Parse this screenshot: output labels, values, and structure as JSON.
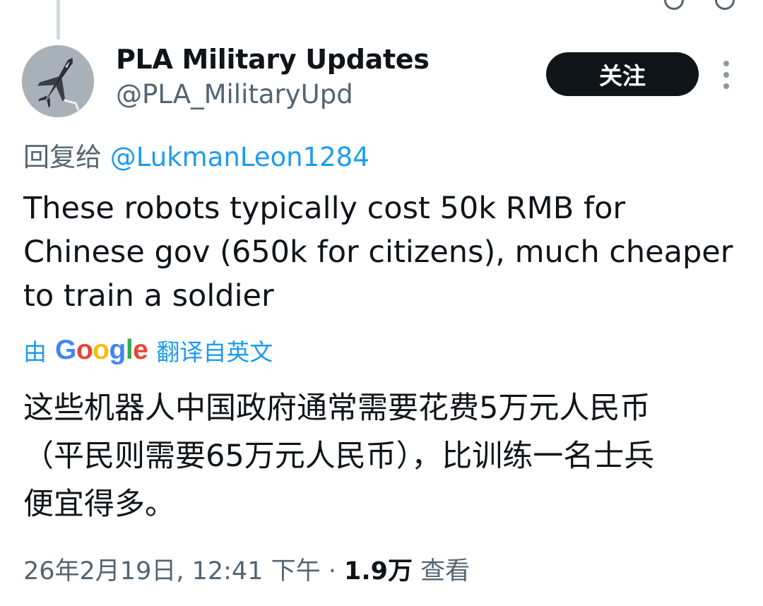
{
  "author": {
    "display_name": "PLA Military Updates",
    "handle": "@PLA_MilitaryUpd"
  },
  "follow_label": "关注",
  "reply": {
    "prefix": "回复给",
    "mention": "@LukmanLeon1284"
  },
  "tweet_text": "These robots typically cost 50k RMB for\nChinese gov (650k for citizens), much cheaper\nto train a soldier",
  "translation": {
    "by": "由",
    "google_letters": [
      "G",
      "o",
      "o",
      "g",
      "l",
      "e"
    ],
    "suffix": "翻译自英文"
  },
  "translated_text": "这些机器人中国政府通常需要花费5万元人民币\n（平民则需要65万元人民币），比训练一名士兵\n便宜得多。",
  "meta": {
    "timestamp": "26年2月19日, 12:41 下午",
    "separator": "·",
    "views_count": "1.9万",
    "views_label": "查看"
  },
  "colors": {
    "accent": "#1d9bf0",
    "secondary_text": "#536471",
    "primary_text": "#0f1419",
    "button_bg": "#0f1419"
  },
  "icons": [
    "more-options-icon",
    "jet-avatar-icon"
  ]
}
